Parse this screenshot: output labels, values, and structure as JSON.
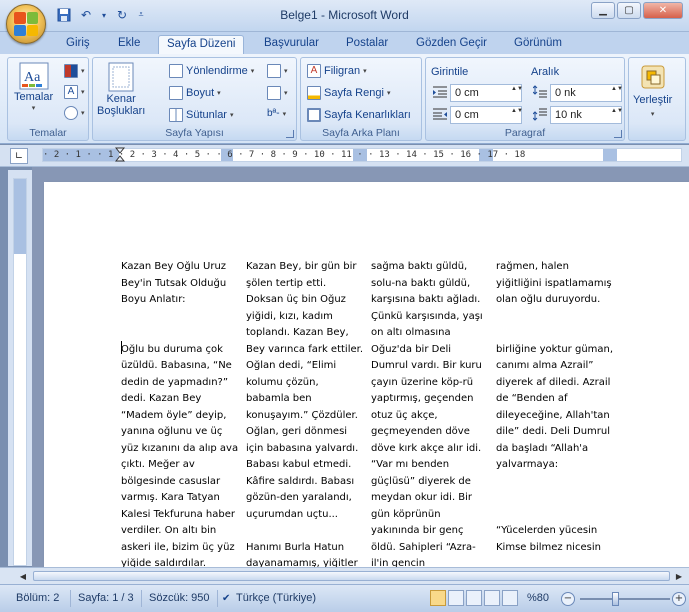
{
  "window": {
    "title": "Belge1 - Microsoft Word"
  },
  "quick_access": {
    "save_icon": "save-icon",
    "undo_icon": "undo-icon",
    "redo_icon": "redo-icon",
    "customize_icon": "customize-icon"
  },
  "tabs": [
    {
      "label": "Giriş",
      "active": false
    },
    {
      "label": "Ekle",
      "active": false
    },
    {
      "label": "Sayfa Düzeni",
      "active": true
    },
    {
      "label": "Başvurular",
      "active": false
    },
    {
      "label": "Postalar",
      "active": false
    },
    {
      "label": "Gözden Geçir",
      "active": false
    },
    {
      "label": "Görünüm",
      "active": false
    }
  ],
  "ribbon": {
    "temalar": {
      "group_label": "Temalar",
      "button": "Temalar"
    },
    "sayfa_yapisi": {
      "group_label": "Sayfa Yapısı",
      "kenar": "Kenar\nBoşlukları",
      "yonlendirme": "Yönlendirme",
      "boyut": "Boyut",
      "sutunlar": "Sütunlar"
    },
    "sayfa_arka_plani": {
      "group_label": "Sayfa Arka Planı",
      "filigran": "Filigran",
      "sayfa_rengi": "Sayfa Rengi",
      "kenarliklar": "Sayfa Kenarlıkları"
    },
    "paragraf": {
      "group_label": "Paragraf",
      "girinti": "Girintile",
      "aralik": "Aralık",
      "left_indent": "0 cm",
      "right_indent": "0 cm",
      "before": "0 nk",
      "after": "10 nk"
    },
    "yerlestir": {
      "button": "Yerleştir"
    }
  },
  "ruler": {
    "numbers": "· 2 · 1 ·     · 1 · 2 · 3 · 4 · 5 ·   · 6 · 7 · 8 · 9 · 10 · 11 ·   · 13 · 14 · 15 · 16 · 17 · 18"
  },
  "document": {
    "columns": [
      "Kazan Bey Oğlu Uruz Bey'in Tutsak Olduğu Boyu Anlatır:\n\n\nOğlu bu duruma çok üzüldü. Babasına, “Ne dedin de yapmadın?” dedi. Kazan Bey “Madem öyle” deyip, yanına oğlunu ve üç yüz kızanını da alıp ava çıktı. Meğer av bölgesinde casuslar varmış. Kara Tatyan Kalesi Tekfuruna haber verdiler. On altı bin askeri ile, bizim üç yüz yiğide saldırdılar.",
      "Kazan Bey, bir gün bir şölen tertip etti. Doksan üç bin Oğuz yiğidi, kızı, kadım toplandı. Kazan Bey, Bey varınca fark ettiler. Oğlan dedi, “Elimi kolumu çözün, babamla ben konuşayım.” Çözdüler. Oğlan, geri dönmesi için babasına yalvardı. Babası kabul etmedi. Kâfire saldırdı. Babası gözün-den yaralandı, uçurumdan uçtu...\n\nHanımı Burla Hatun dayanamamış, yiğitler",
      "sağma baktı güldü, solu-na baktı güldü, karşısına baktı ağladı. Çünkü karşısında, yaşı on altı olmasına Oğuz'da bir Deli Dumrul vardı. Bir kuru çayın üzerine köp-rü yaptırmış, geçenden otuz üç akçe, geçmeyenden döve döve kırk akçe alır idi. “Var mı benden güçlüsü” diyerek de meydan okur idi. Bir gün köprünün yakınında bir genç öldü. Sahipleri “Azra-il'in gencin",
      "rağmen, halen yiğitliğini ispatlamamış olan oğlu duruyordu.\n\n\nbirliğine yoktur güman, canımı alma Azrail” diyerek af diledi. Azrail de “Benden af dileyeceğine, Allah'tan dile” dedi. Deli Dumrul da başladı “Allah'a yalvarmaya:\n\n\n\n“Yücelerden yücesin Kimse bilmez nicesin"
    ]
  },
  "status": {
    "section": "Bölüm: 2",
    "page": "Sayfa: 1 / 3",
    "words": "Sözcük: 950",
    "language": "Türkçe (Türkiye)",
    "zoom": "%80"
  },
  "colors": {
    "accent": "#15428b",
    "ribbon_bg": "#dbe7f7",
    "canvas": "#8797b5"
  }
}
